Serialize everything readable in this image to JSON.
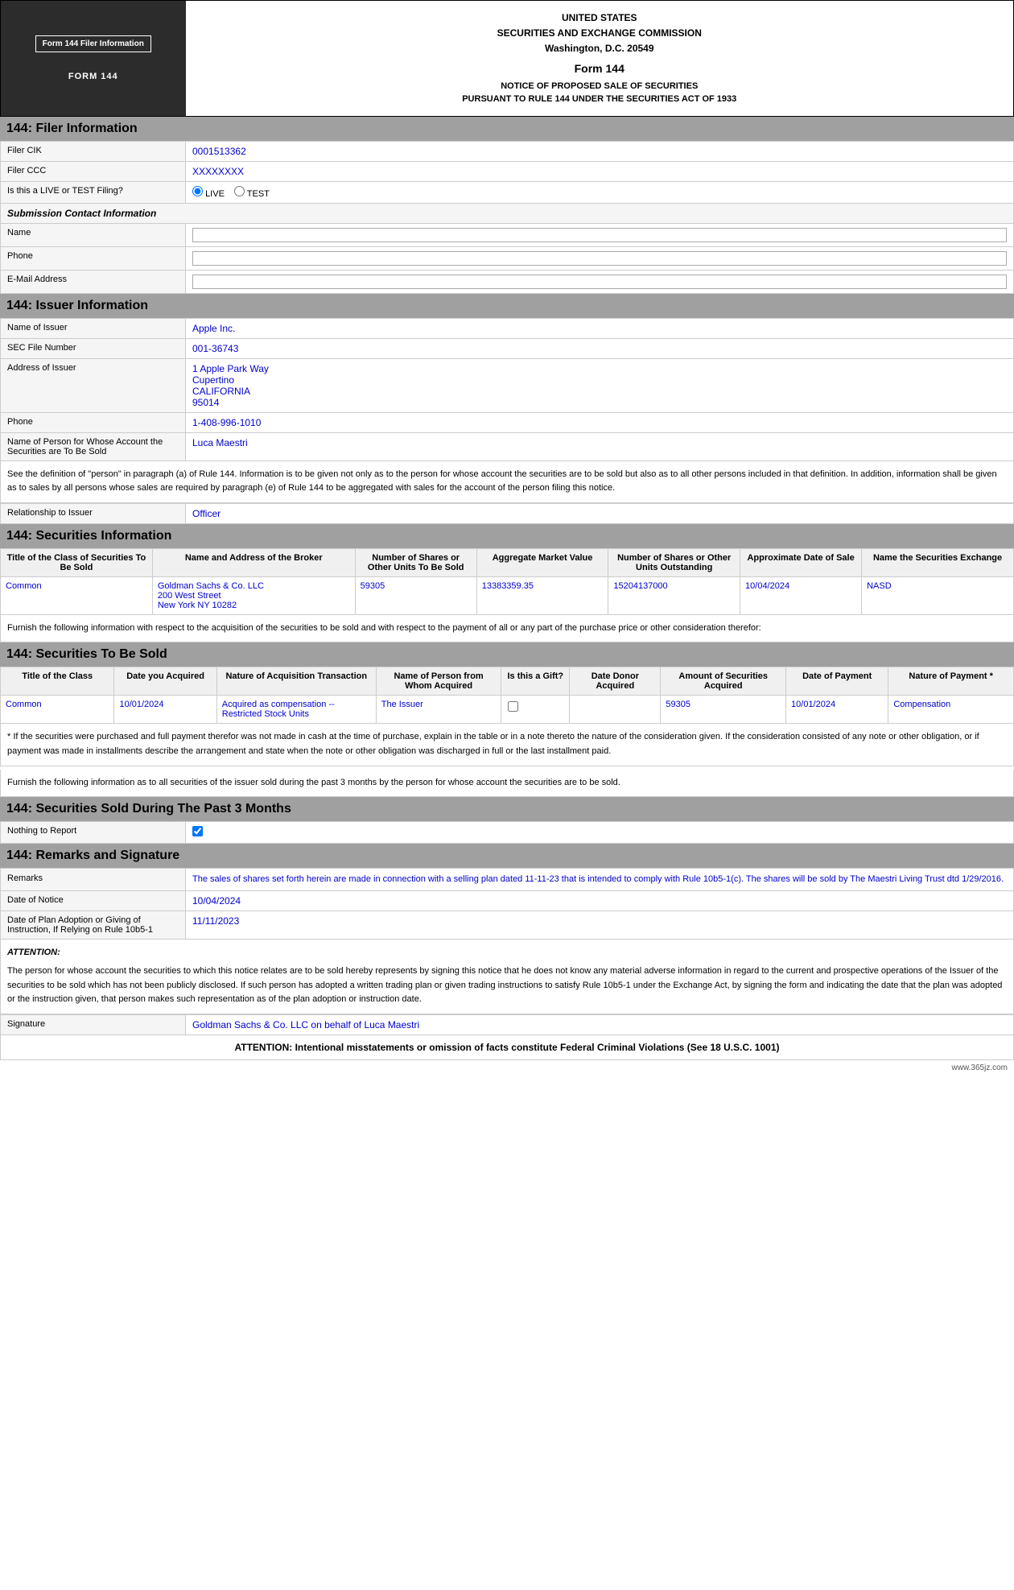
{
  "header": {
    "form_info_label": "Form 144 Filer Information",
    "form_144_label": "FORM 144",
    "agency_line1": "UNITED STATES",
    "agency_line2": "SECURITIES AND EXCHANGE COMMISSION",
    "agency_line3": "Washington, D.C. 20549",
    "form_title": "Form 144",
    "notice_line1": "NOTICE OF PROPOSED SALE OF SECURITIES",
    "notice_line2": "PURSUANT TO RULE 144 UNDER THE SECURITIES ACT OF 1933"
  },
  "filer_section": {
    "title": "144: Filer Information",
    "filer_cik_label": "Filer CIK",
    "filer_cik_value": "0001513362",
    "filer_ccc_label": "Filer CCC",
    "filer_ccc_value": "XXXXXXXX",
    "live_test_label": "Is this a LIVE or TEST Filing?",
    "live_label": "LIVE",
    "test_label": "TEST",
    "submission_contact_label": "Submission Contact Information",
    "name_label": "Name",
    "phone_label": "Phone",
    "email_label": "E-Mail Address"
  },
  "issuer_section": {
    "title": "144: Issuer Information",
    "name_label": "Name of Issuer",
    "name_value": "Apple Inc.",
    "sec_file_label": "SEC File Number",
    "sec_file_value": "001-36743",
    "address_label": "Address of Issuer",
    "address_line1": "1 Apple Park Way",
    "address_line2": "Cupertino",
    "address_line3": "CALIFORNIA",
    "address_line4": "95014",
    "phone_label": "Phone",
    "phone_value": "1-408-996-1010",
    "person_label": "Name of Person for Whose Account the Securities are To Be Sold",
    "person_value": "Luca Maestri",
    "info_text": "See the definition of \"person\" in paragraph (a) of Rule 144. Information is to be given not only as to the person for whose account the securities are to be sold but also as to all other persons included in that definition. In addition, information shall be given as to sales by all persons whose sales are required by paragraph (e) of Rule 144 to be aggregated with sales for the account of the person filing this notice.",
    "relationship_label": "Relationship to Issuer",
    "relationship_value": "Officer"
  },
  "securities_info_section": {
    "title": "144: Securities Information",
    "col1": "Title of the Class of Securities To Be Sold",
    "col2": "Name and Address of the Broker",
    "col3": "Number of Shares or Other Units To Be Sold",
    "col4": "Aggregate Market Value",
    "col5": "Number of Shares or Other Units Outstanding",
    "col6": "Approximate Date of Sale",
    "col7": "Name the Securities Exchange",
    "row1": {
      "class": "Common",
      "broker_name": "Goldman Sachs & Co. LLC",
      "broker_addr1": "200 West Street",
      "broker_addr2": "New York  NY  10282",
      "shares": "59305",
      "market_value": "13383359.35",
      "outstanding": "15204137000",
      "date": "10/04/2024",
      "exchange": "NASD"
    },
    "furnish_text": "Furnish the following information with respect to the acquisition of the securities to be sold and with respect to the payment of all or any part of the purchase price or other consideration therefor:"
  },
  "securities_sold_section": {
    "title": "144: Securities To Be Sold",
    "col1": "Title of the Class",
    "col2": "Date you Acquired",
    "col3": "Nature of Acquisition Transaction",
    "col4": "Name of Person from Whom Acquired",
    "col5": "Is this a Gift?",
    "col6": "Date Donor Acquired",
    "col7": "Amount of Securities Acquired",
    "col8": "Date of Payment",
    "col9": "Nature of Payment *",
    "row1": {
      "class": "Common",
      "date_acquired": "10/01/2024",
      "nature": "Acquired as compensation -- Restricted Stock Units",
      "person_from": "The Issuer",
      "is_gift": false,
      "date_donor": "",
      "amount": "59305",
      "date_payment": "10/01/2024",
      "nature_payment": "Compensation"
    },
    "footnote": "* If the securities were purchased and full payment therefor was not made in cash at the time of purchase, explain in the table or in a note thereto the nature of the consideration given. If the consideration consisted of any note or other obligation, or if payment was made in installments describe the arrangement and state when the note or other obligation was discharged in full or the last installment paid.",
    "furnish_text": "Furnish the following information as to all securities of the issuer sold during the past 3 months by the person for whose account the securities are to be sold."
  },
  "past3months_section": {
    "title": "144: Securities Sold During The Past 3 Months",
    "nothing_label": "Nothing to Report",
    "checked": true
  },
  "remarks_section": {
    "title": "144: Remarks and Signature",
    "remarks_label": "Remarks",
    "remarks_value": "The sales of shares set forth herein are made in connection with a selling plan dated 11-11-23 that is intended to comply with Rule 10b5-1(c). The shares will be sold by The Maestri Living Trust dtd 1/29/2016.",
    "date_notice_label": "Date of Notice",
    "date_notice_value": "10/04/2024",
    "date_plan_label": "Date of Plan Adoption or Giving of Instruction, If Relying on Rule 10b5-1",
    "date_plan_value": "11/11/2023",
    "attention_label": "ATTENTION:",
    "attention_text": "The person for whose account the securities to which this notice relates are to be sold hereby represents by signing this notice that he does not know any material adverse information in regard to the current and prospective operations of the Issuer of the securities to be sold which has not been publicly disclosed. If such person has adopted a written trading plan or given trading instructions to satisfy Rule 10b5-1 under the Exchange Act, by signing the form and indicating the date that the plan was adopted or the instruction given, that person makes such representation as of the plan adoption or instruction date.",
    "signature_label": "Signature",
    "signature_value": "Goldman Sachs & Co. LLC on behalf of Luca Maestri"
  },
  "footer": {
    "attention_text": "ATTENTION: Intentional misstatements or omission of facts constitute Federal Criminal Violations (See 18 U.S.C. 1001)",
    "website": "www.365jz.com"
  }
}
